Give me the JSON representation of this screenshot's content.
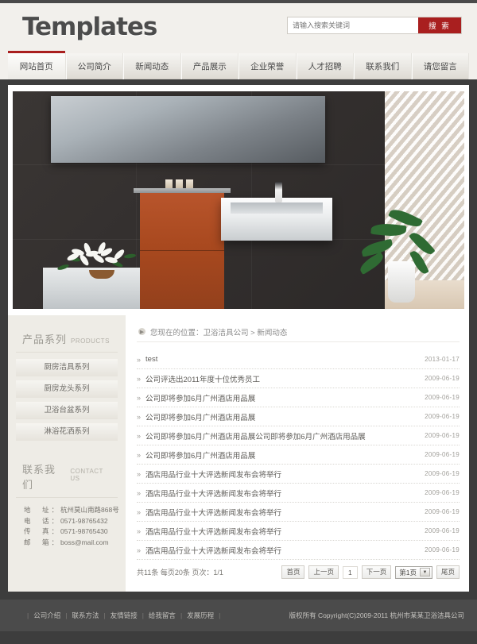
{
  "header": {
    "logo": "Templates",
    "search": {
      "placeholder": "请输入搜索关键词",
      "value": "",
      "button_label": "搜 索"
    }
  },
  "nav": {
    "items": [
      {
        "label": "网站首页",
        "active": true
      },
      {
        "label": "公司简介",
        "active": false
      },
      {
        "label": "新闻动态",
        "active": false
      },
      {
        "label": "产品展示",
        "active": false
      },
      {
        "label": "企业荣誉",
        "active": false
      },
      {
        "label": "人才招聘",
        "active": false
      },
      {
        "label": "联系我们",
        "active": false
      },
      {
        "label": "请您留言",
        "active": false
      }
    ]
  },
  "banner": {
    "alt": "现代卫浴间展示图：深灰墙面、长镜、橙木浴室柜、白色台盆、百合花与绿植"
  },
  "sidebar": {
    "products": {
      "title_cn": "产品系列",
      "title_en": "PRODUCTS",
      "items": [
        "厨房洁具系列",
        "厨房龙头系列",
        "卫浴台盆系列",
        "淋浴花洒系列"
      ]
    },
    "contact": {
      "title_cn": "联系我们",
      "title_en": "CONTACT US",
      "rows": [
        {
          "label": "地　址：",
          "value": "杭州莫山南路868号"
        },
        {
          "label": "电　话：",
          "value": "0571-98765432"
        },
        {
          "label": "传　真：",
          "value": "0571-98765430"
        },
        {
          "label": "邮　箱：",
          "value": "boss@mail.com"
        }
      ]
    }
  },
  "main": {
    "breadcrumb": "您现在的位置：卫浴洁具公司  > 新闻动态",
    "news": [
      {
        "title": "test",
        "date": "2013-01-17"
      },
      {
        "title": "公司评选出2011年度十位优秀员工",
        "date": "2009-06-19"
      },
      {
        "title": "公司即将参加6月广州酒店用品展",
        "date": "2009-06-19"
      },
      {
        "title": "公司即将参加6月广州酒店用品展",
        "date": "2009-06-19"
      },
      {
        "title": "公司即将参加6月广州酒店用品展公司即将参加6月广州酒店用品展",
        "date": "2009-06-19"
      },
      {
        "title": "公司即将参加6月广州酒店用品展",
        "date": "2009-06-19"
      },
      {
        "title": "酒店用品行业十大评选新闻发布会将举行",
        "date": "2009-06-19"
      },
      {
        "title": "酒店用品行业十大评选新闻发布会将举行",
        "date": "2009-06-19"
      },
      {
        "title": "酒店用品行业十大评选新闻发布会将举行",
        "date": "2009-06-19"
      },
      {
        "title": "酒店用品行业十大评选新闻发布会将举行",
        "date": "2009-06-19"
      },
      {
        "title": "酒店用品行业十大评选新闻发布会将举行",
        "date": "2009-06-19"
      }
    ],
    "pager": {
      "info": "共11条 每页20条 页次：1/1",
      "first": "首页",
      "prev": "上一页",
      "current_num": "1",
      "next": "下一页",
      "select_value": "第1页",
      "last": "尾页"
    }
  },
  "footer": {
    "links": [
      "公司介绍",
      "联系方法",
      "友情链接",
      "给我留言",
      "发展历程"
    ],
    "copyright": "版权所有  Copyright(C)2009-2011 杭州市某某卫浴洁具公司"
  },
  "colors": {
    "accent_red": "#a91f1f",
    "header_bg": "#f2f0ec",
    "sidebar_bg": "#eeece6",
    "footer_bg": "#4b4b4b",
    "page_bg": "#3d3d3d"
  }
}
